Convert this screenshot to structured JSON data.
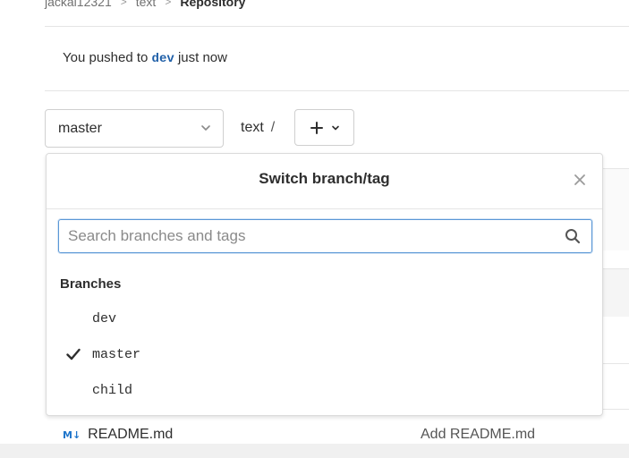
{
  "breadcrumb": {
    "items": [
      "jackal12321",
      "text",
      "Repository"
    ]
  },
  "notice": {
    "prefix": "You pushed to",
    "branch": "dev",
    "suffix": "just now"
  },
  "toolbar": {
    "branch_selected": "master",
    "path": "text",
    "path_sep": "/"
  },
  "dropdown": {
    "title": "Switch branch/tag",
    "search_placeholder": "Search branches and tags",
    "section_label": "Branches",
    "branches": [
      {
        "name": "dev",
        "selected": false
      },
      {
        "name": "master",
        "selected": true
      },
      {
        "name": "child",
        "selected": false
      }
    ]
  },
  "files": {
    "rows": [
      {
        "name": "README.md",
        "commit": "Add README.md",
        "icon": "markdown-icon",
        "icon_glyph": "M↓"
      }
    ]
  },
  "colors": {
    "accent": "#1f75cb",
    "focus_border": "#5a97d6"
  }
}
